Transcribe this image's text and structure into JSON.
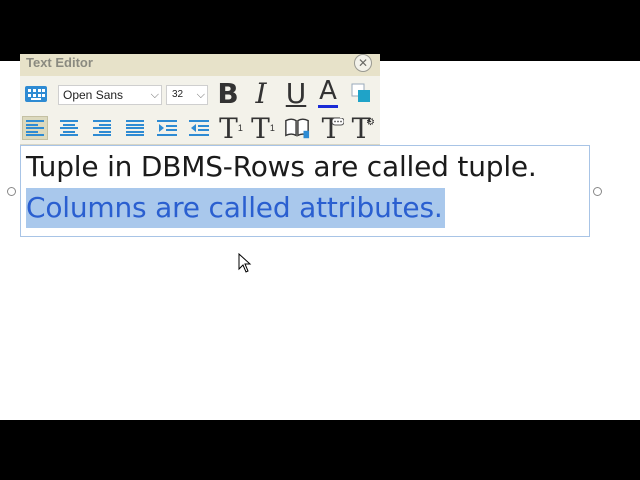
{
  "editor": {
    "title": "Text Editor",
    "close_icon": "close-icon",
    "font_family": "Open Sans",
    "font_size": "32",
    "bold_label": "B",
    "italic_label": "I",
    "underline_label": "U",
    "font_color_label": "A",
    "font_color": "#1a2bd6",
    "accent": "#2e8bd3",
    "t_label": "T",
    "subscript_label": "1",
    "superscript_label": "1"
  },
  "document": {
    "line1": "Tuple in DBMS-Rows are called tuple.",
    "line2": "Columns are called attributes.",
    "selection_color": "#a9c8ec",
    "selected_text_color": "#2a5fd0"
  }
}
